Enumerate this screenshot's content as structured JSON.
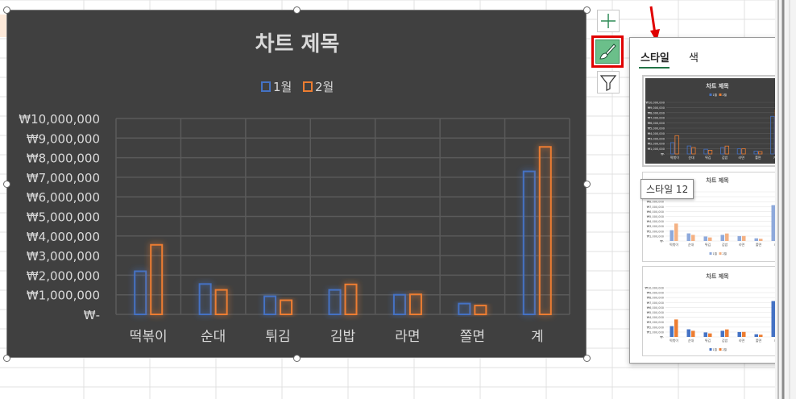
{
  "chart_data": {
    "type": "bar",
    "title": "차트 제목",
    "categories": [
      "떡볶이",
      "순대",
      "튀김",
      "김밥",
      "라면",
      "쫄면",
      "계"
    ],
    "series": [
      {
        "name": "1월",
        "values": [
          2200000,
          1550000,
          920000,
          1250000,
          1000000,
          550000,
          7300000
        ]
      },
      {
        "name": "2월",
        "values": [
          3550000,
          1250000,
          720000,
          1530000,
          1020000,
          450000,
          8550000
        ]
      }
    ],
    "ylim": [
      0,
      10000000
    ],
    "yticks": [
      "₩-",
      "₩1,000,000",
      "₩2,000,000",
      "₩3,000,000",
      "₩4,000,000",
      "₩5,000,000",
      "₩6,000,000",
      "₩7,000,000",
      "₩8,000,000",
      "₩9,000,000",
      "₩10,000,000"
    ],
    "legend_position": "top",
    "grid": true,
    "colors": {
      "series1": "#4472c4",
      "series2": "#ed7d31",
      "background": "#404040",
      "grid": "#5a5a5a"
    }
  },
  "panel": {
    "tabs": [
      {
        "label": "스타일"
      },
      {
        "label": "색"
      }
    ],
    "thumb_title": "차트 제목",
    "thumb_legend": [
      "1월",
      "2월"
    ],
    "tooltip": "스타일 12"
  },
  "icons": {
    "add": "plus-icon",
    "style": "paintbrush-icon",
    "filter": "funnel-icon"
  }
}
